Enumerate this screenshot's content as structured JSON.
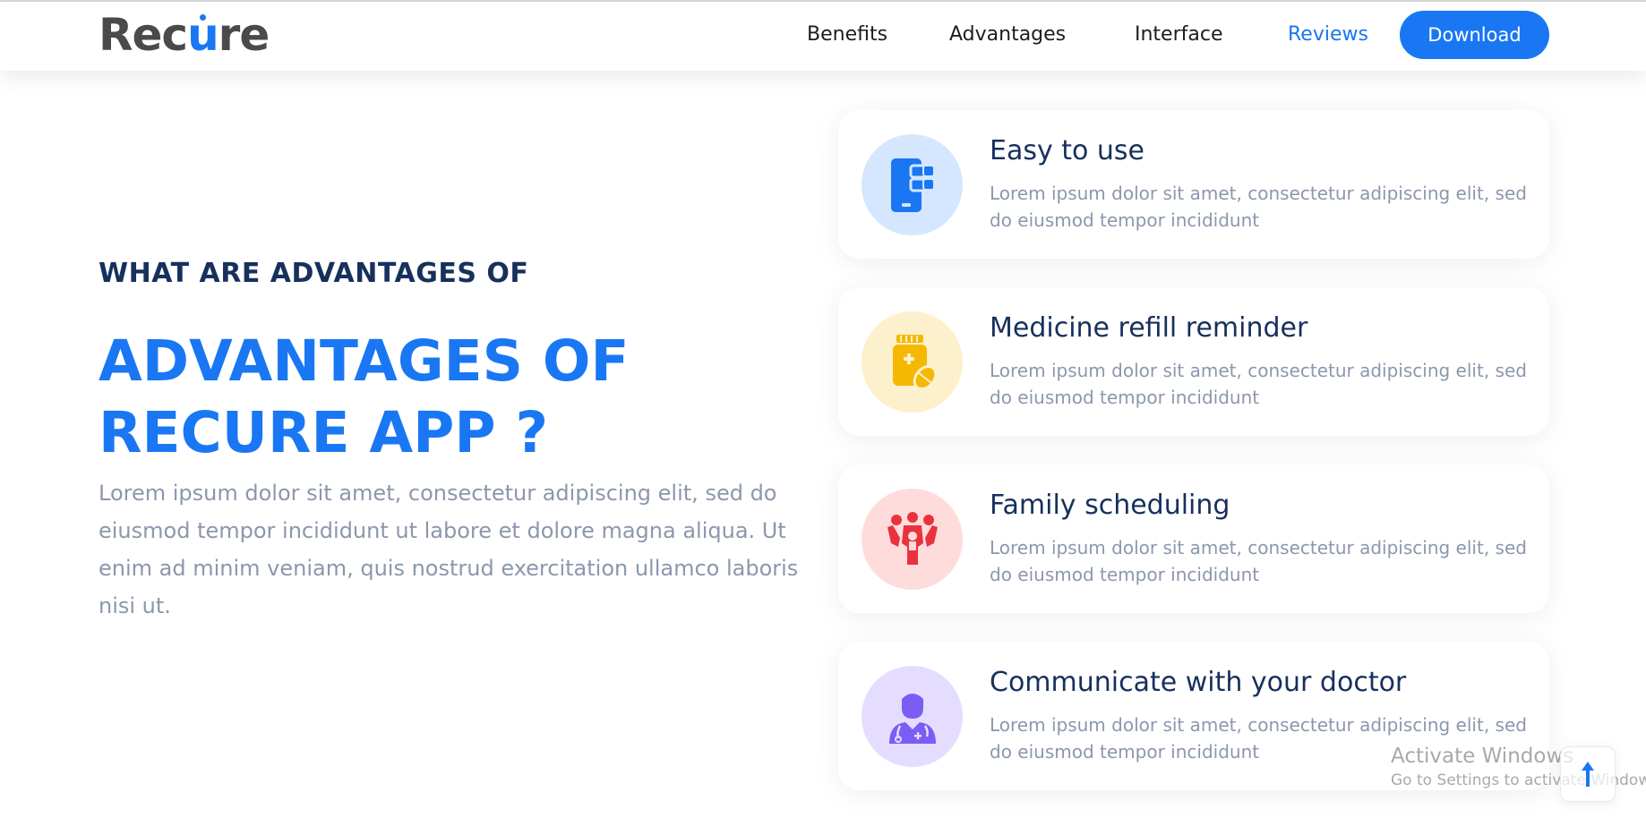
{
  "header": {
    "logo_text_before": "Rec",
    "logo_text_u": "u",
    "logo_text_after": "re",
    "nav": [
      {
        "label": "Benefits",
        "active": false
      },
      {
        "label": "Advantages",
        "active": false
      },
      {
        "label": "Interface",
        "active": false
      },
      {
        "label": "Reviews",
        "active": true
      }
    ],
    "download_label": "Download"
  },
  "hero": {
    "subtitle": "WHAT ARE ADVANTAGES OF",
    "headline_line1": "ADVANTAGES OF",
    "headline_line2": "RECURE APP ?",
    "description": "Lorem ipsum dolor sit amet, consectetur adipiscing elit, sed do eiusmod tempor incididunt ut labore et dolore magna aliqua. Ut enim ad minim veniam, quis nostrud exercitation ullamco laboris nisi ut."
  },
  "features": [
    {
      "title": "Easy to use",
      "description": "Lorem ipsum dolor sit amet, consectetur adipiscing elit, sed do eiusmod tempor incididunt",
      "icon": "mobile-app-icon",
      "circle_color": "#d5e6ff",
      "icon_color": "#1977f3"
    },
    {
      "title": "Medicine refill reminder",
      "description": "Lorem ipsum dolor sit amet, consectetur adipiscing elit, sed do eiusmod tempor incididunt",
      "icon": "medicine-bottle-icon",
      "circle_color": "#fdf0cc",
      "icon_color": "#f5b800"
    },
    {
      "title": "Family scheduling",
      "description": "Lorem ipsum dolor sit amet, consectetur adipiscing elit, sed do eiusmod tempor incididunt",
      "icon": "family-icon",
      "circle_color": "#ffdcdc",
      "icon_color": "#e8333f"
    },
    {
      "title": "Communicate with your doctor",
      "description": "Lorem ipsum dolor sit amet, consectetur adipiscing elit, sed do eiusmod tempor incididunt",
      "icon": "doctor-icon",
      "circle_color": "#e4ddff",
      "icon_color": "#7c5cf5"
    }
  ],
  "watermark": {
    "line1": "Activate Windows",
    "line2": "Go to Settings to activate Windows."
  },
  "colors": {
    "accent": "#1977f3",
    "heading": "#17305c",
    "muted": "#8c97ad"
  }
}
